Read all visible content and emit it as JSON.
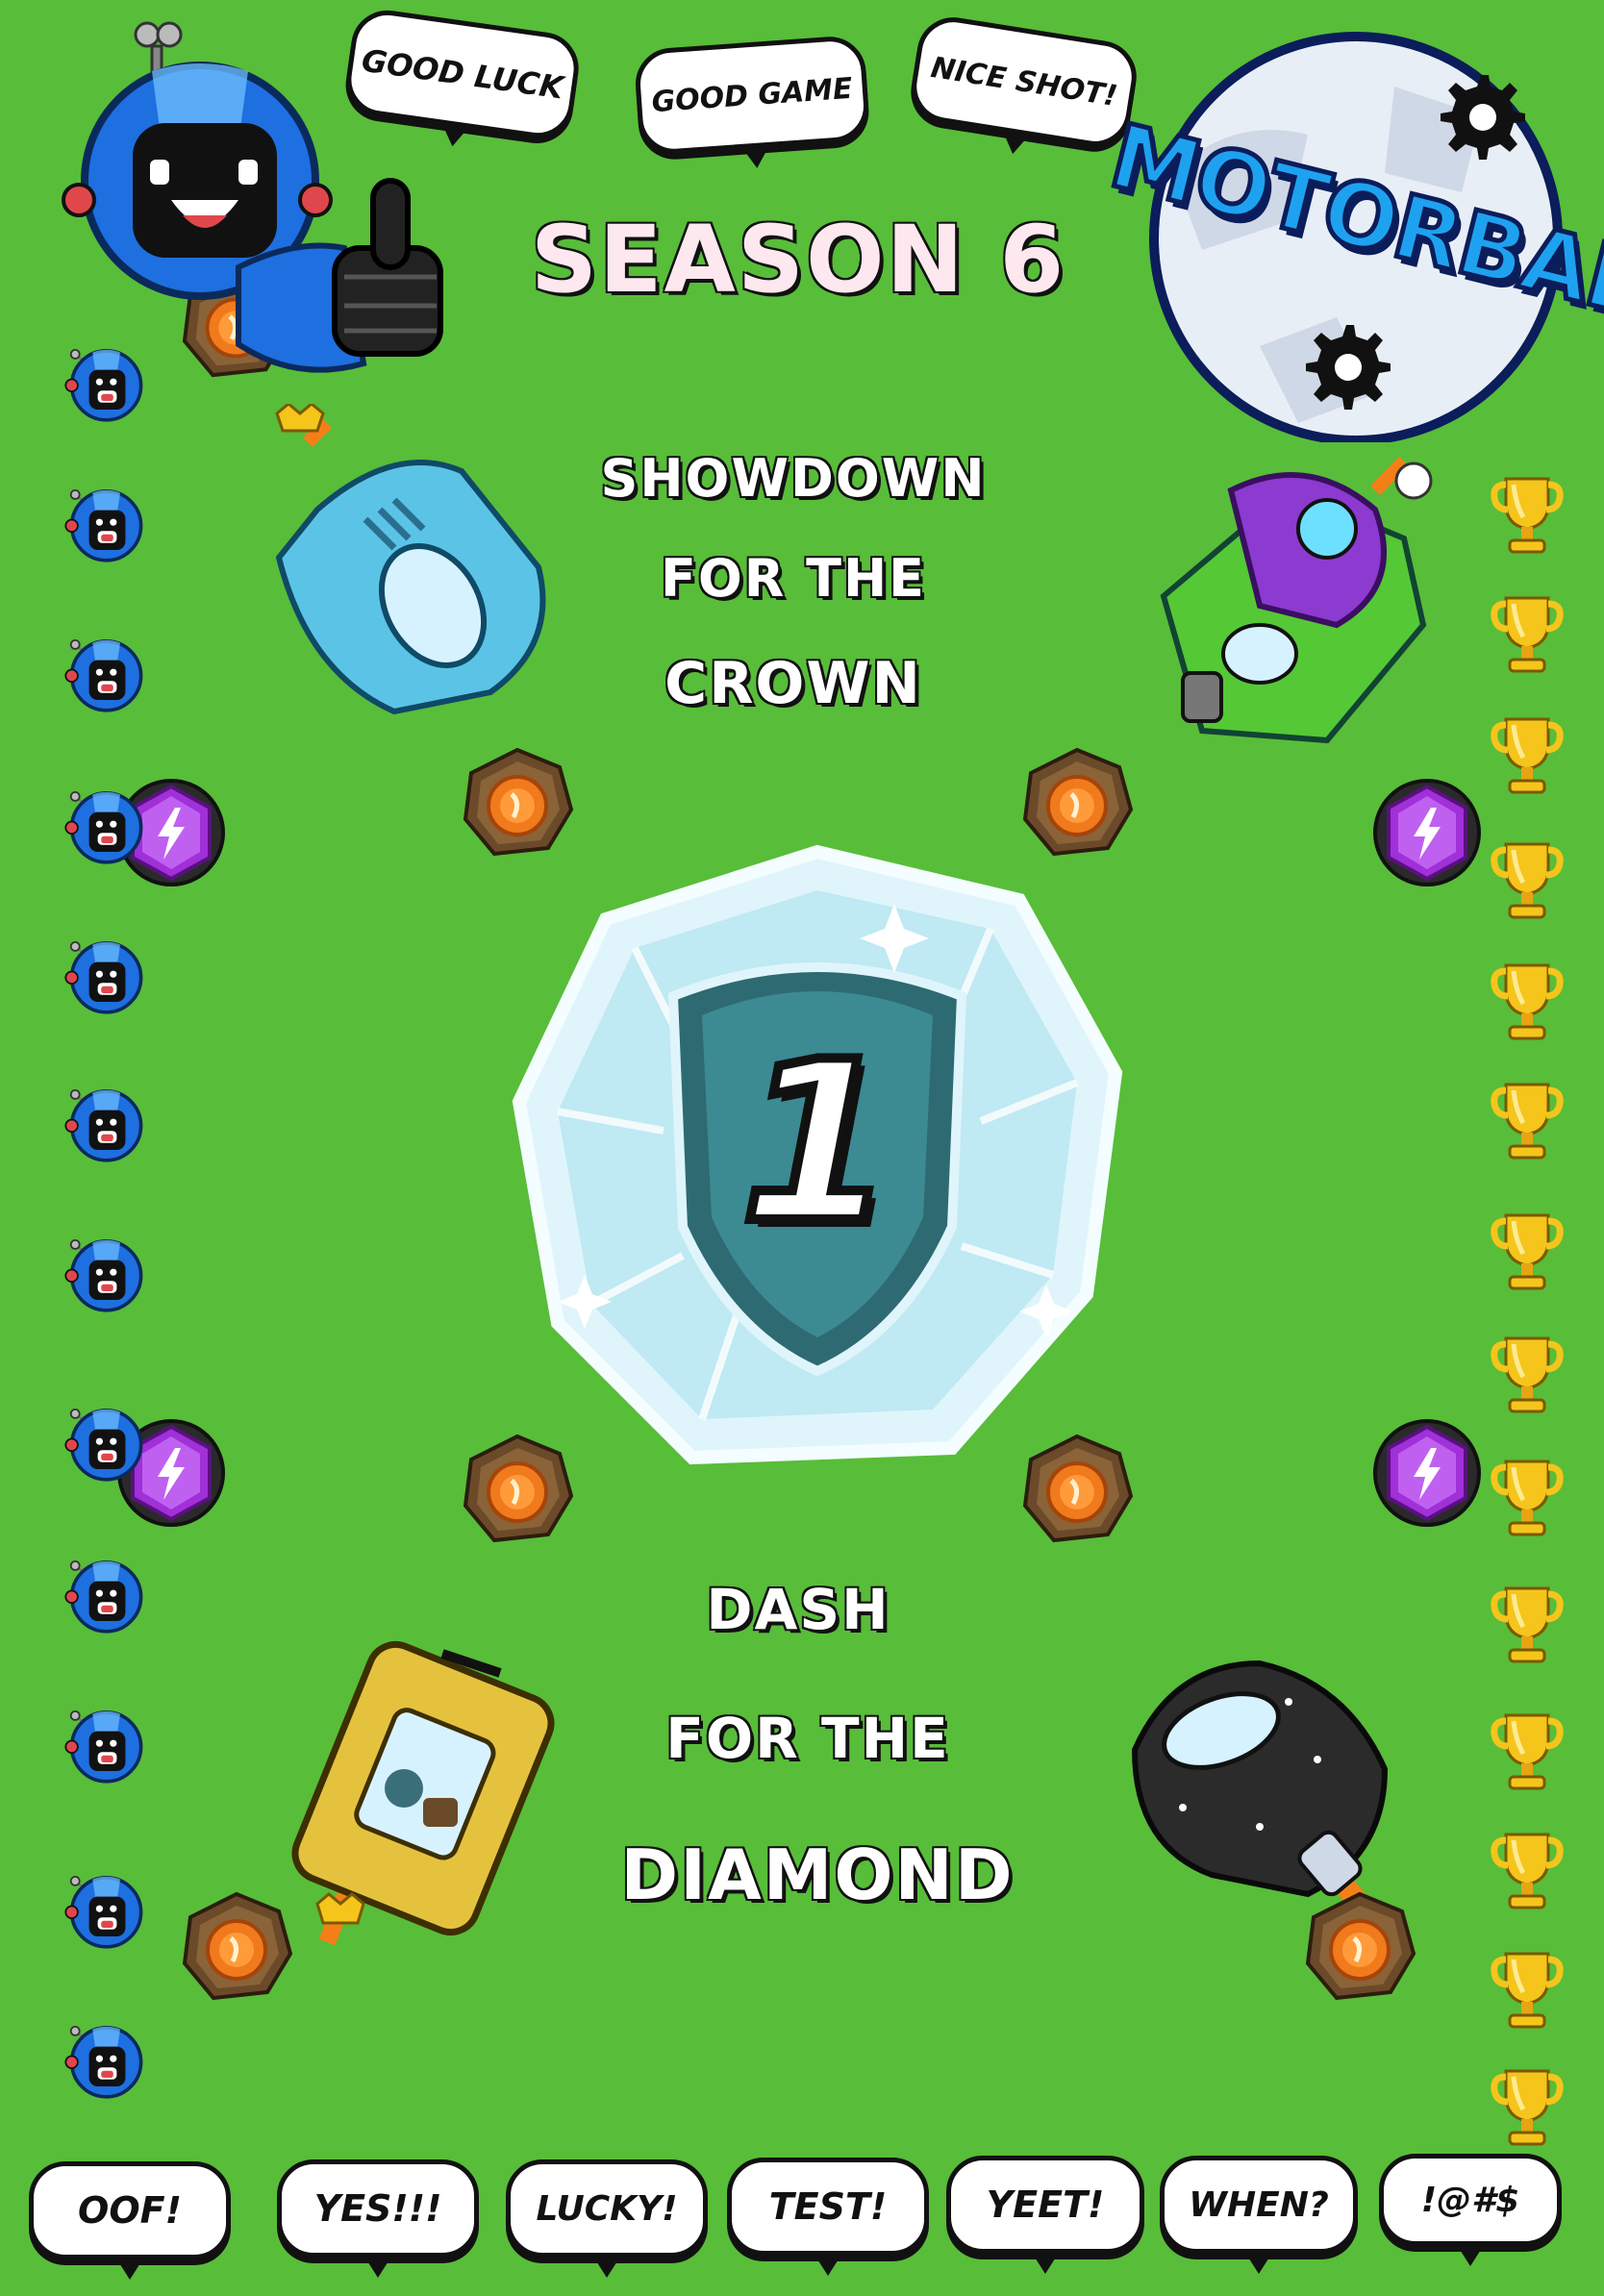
{
  "header": {
    "season_title": "SEASON 6",
    "logo_text": "MOTORBALL"
  },
  "top_bubbles": [
    "GOOD LUCK",
    "GOOD GAME",
    "NICE SHOT!"
  ],
  "taglines": {
    "crown": [
      "SHOWDOWN",
      "FOR THE",
      "CROWN"
    ],
    "diamond": [
      "DASH",
      "FOR THE",
      "DIAMOND"
    ]
  },
  "rank_badge": {
    "value": "1"
  },
  "bottom_bubbles": [
    "OOF!",
    "YES!!!",
    "LUCKY!",
    "TEST!",
    "YEET!",
    "WHEN?",
    "!@#$"
  ],
  "colors": {
    "background": "#58bd39",
    "robot_blue": "#1e6fe0",
    "coin_orange": "#f07a1c",
    "gem_purple": "#a030d8",
    "trophy_gold": "#f5c51c",
    "logo_blue": "#1ea2f0"
  },
  "icons": [
    "robot-mascot-icon",
    "robot-head-icon",
    "trophy-icon",
    "coin-icon",
    "lightning-gem-icon",
    "car-icon",
    "gear-icon"
  ]
}
